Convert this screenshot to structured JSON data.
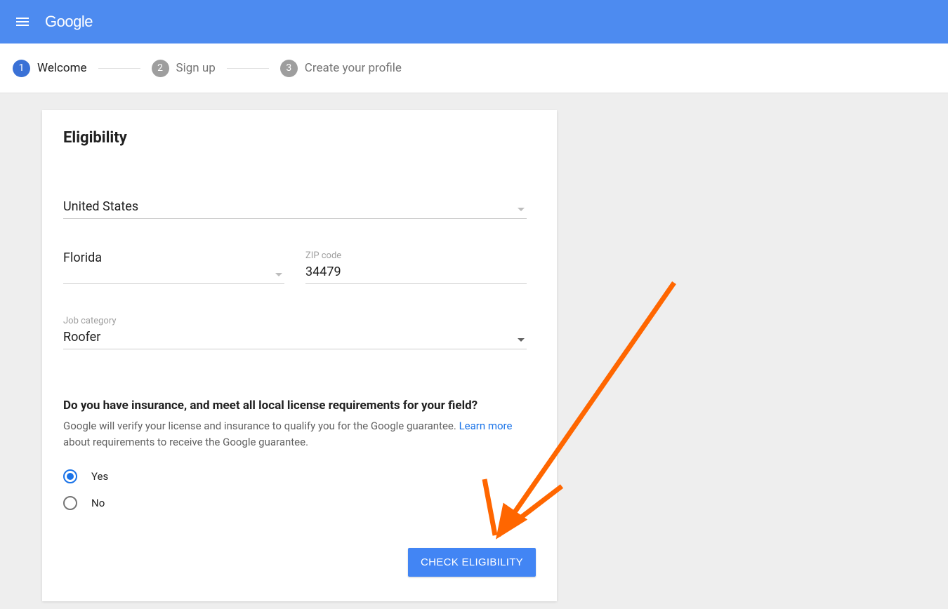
{
  "header": {
    "logo_text": "Google"
  },
  "stepper": {
    "steps": [
      {
        "num": "1",
        "label": "Welcome",
        "active": true
      },
      {
        "num": "2",
        "label": "Sign up",
        "active": false
      },
      {
        "num": "3",
        "label": "Create your profile",
        "active": false
      }
    ]
  },
  "card": {
    "title": "Eligibility",
    "country": {
      "value": "United States"
    },
    "state": {
      "value": "Florida"
    },
    "zip": {
      "label": "ZIP code",
      "value": "34479"
    },
    "job_category": {
      "label": "Job category",
      "value": "Roofer"
    },
    "question": {
      "title": "Do you have insurance, and meet all local license requirements for your field?",
      "desc_1": "Google will verify your license and insurance to qualify you for the Google guarantee. ",
      "learn_more": "Learn more",
      "desc_2": " about requirements to receive the Google guarantee.",
      "options": {
        "yes": "Yes",
        "no": "No"
      }
    },
    "cta_label": "CHECK ELIGIBILITY"
  }
}
